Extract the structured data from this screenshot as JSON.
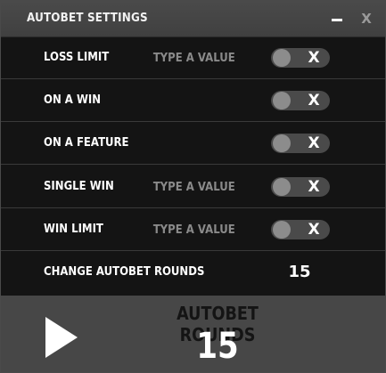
{
  "window": {
    "title": "AUTOBET SETTINGS",
    "minimize_icon": "minimize-icon",
    "close_label": "X"
  },
  "settings": {
    "rows": [
      {
        "label": "LOSS LIMIT",
        "placeholder": "TYPE A VALUE",
        "toggle_label": "X",
        "toggle_on": false
      },
      {
        "label": "ON A WIN",
        "toggle_label": "X",
        "toggle_on": false
      },
      {
        "label": "ON A FEATURE",
        "toggle_label": "X",
        "toggle_on": false
      },
      {
        "label": "SINGLE WIN",
        "placeholder": "TYPE A VALUE",
        "toggle_label": "X",
        "toggle_on": false
      },
      {
        "label": "WIN LIMIT",
        "placeholder": "TYPE A VALUE",
        "toggle_label": "X",
        "toggle_on": false
      }
    ],
    "change_rounds": {
      "label": "CHANGE AUTOBET ROUNDS",
      "value": "15"
    }
  },
  "footer": {
    "title": "AUTOBET ROUNDS",
    "value": "15",
    "play_icon": "play-icon"
  },
  "colors": {
    "background": "#141414",
    "titlebar": "#444444",
    "footer": "#474747",
    "toggle_track": "#4a4a4a",
    "toggle_knob": "#8c8c8c",
    "muted_text": "#8a8a8a"
  }
}
